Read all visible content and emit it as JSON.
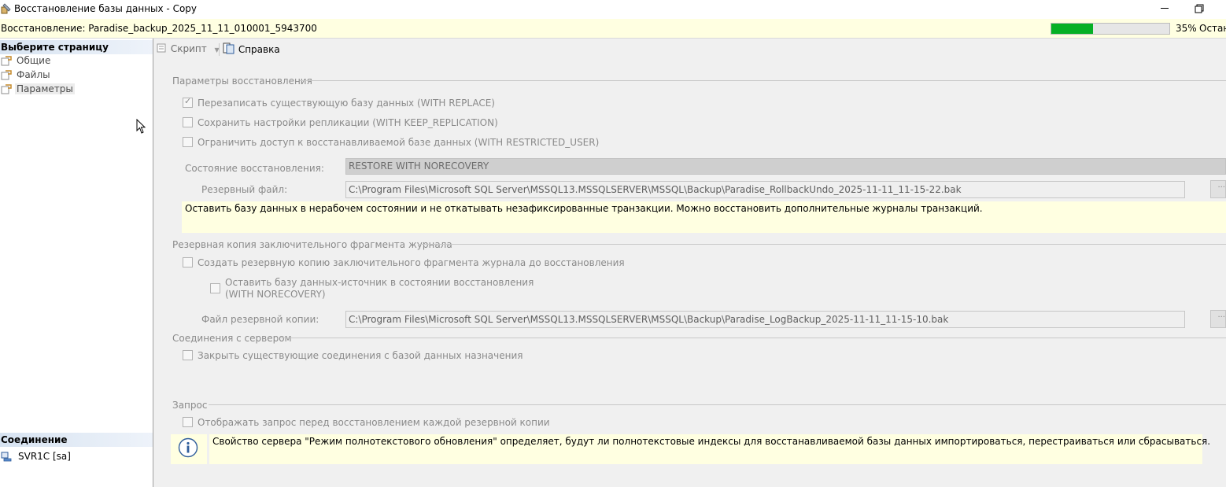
{
  "window": {
    "title": "Восстановление базы данных - Copy"
  },
  "progress": {
    "text": "Восстановление: Paradise_backup_2025_11_11_010001_5943700",
    "percent": 35,
    "percent_text": "35%",
    "stop_label": "Остан"
  },
  "left": {
    "select_page_header": "Выберите страницу",
    "pages": [
      {
        "label": "Общие"
      },
      {
        "label": "Файлы"
      },
      {
        "label": "Параметры"
      }
    ],
    "connection_header": "Соединение",
    "connection_value": "SVR1C [sa]"
  },
  "toolbar": {
    "script_label": "Скрипт",
    "help_label": "Справка"
  },
  "restore_options": {
    "group_title": "Параметры восстановления",
    "with_replace": {
      "label": "Перезаписать существующую базу данных (WITH REPLACE)",
      "checked": true
    },
    "keep_replication": {
      "label": "Сохранить настройки репликации (WITH KEEP_REPLICATION)",
      "checked": false
    },
    "restricted_user": {
      "label": "Ограничить доступ к восстанавливаемой базе данных (WITH RESTRICTED_USER)",
      "checked": false
    },
    "recovery_state_label": "Состояние восстановления:",
    "recovery_state_value": "RESTORE WITH NORECOVERY",
    "standby_file_label": "Резервный файл:",
    "standby_file_value": "C:\\Program Files\\Microsoft SQL Server\\MSSQL13.MSSQLSERVER\\MSSQL\\Backup\\Paradise_RollbackUndo_2025-11-11_11-15-22.bak",
    "browse_label": "...",
    "state_description": "Оставить базу данных в нерабочем состоянии и не откатывать незафиксированные транзакции. Можно восстановить дополнительные журналы транзакций."
  },
  "tail_log": {
    "group_title": "Резервная копия заключительного фрагмента журнала",
    "take_tail_log": {
      "label": "Создать резервную копию заключительного фрагмента журнала до восстановления",
      "checked": false
    },
    "leave_norecovery": {
      "label_line1": "Оставить базу данных-источник в состоянии восстановления",
      "label_line2": "(WITH NORECOVERY)",
      "checked": false
    },
    "backup_file_label": "Файл резервной копии:",
    "backup_file_value": "C:\\Program Files\\Microsoft SQL Server\\MSSQL13.MSSQLSERVER\\MSSQL\\Backup\\Paradise_LogBackup_2025-11-11_11-15-10.bak",
    "browse_label": "..."
  },
  "server_connections": {
    "group_title": "Соединения с сервером",
    "close_connections": {
      "label": "Закрыть существующие соединения с базой данных назначения",
      "checked": false
    }
  },
  "prompt": {
    "group_title": "Запрос",
    "prompt_before_each": {
      "label": "Отображать запрос перед восстановлением каждой резервной копии",
      "checked": false
    }
  },
  "info_note": {
    "text": "Свойство сервера \"Режим полнотекстового обновления\" определяет, будут ли полнотекстовые индексы для восстанавливаемой базы данных импортироваться, перестраиваться или сбрасываться."
  },
  "colors": {
    "progress_fill": "#06b025",
    "note_background": "#ffffe1",
    "header_gradient": "#d7e3f1"
  }
}
